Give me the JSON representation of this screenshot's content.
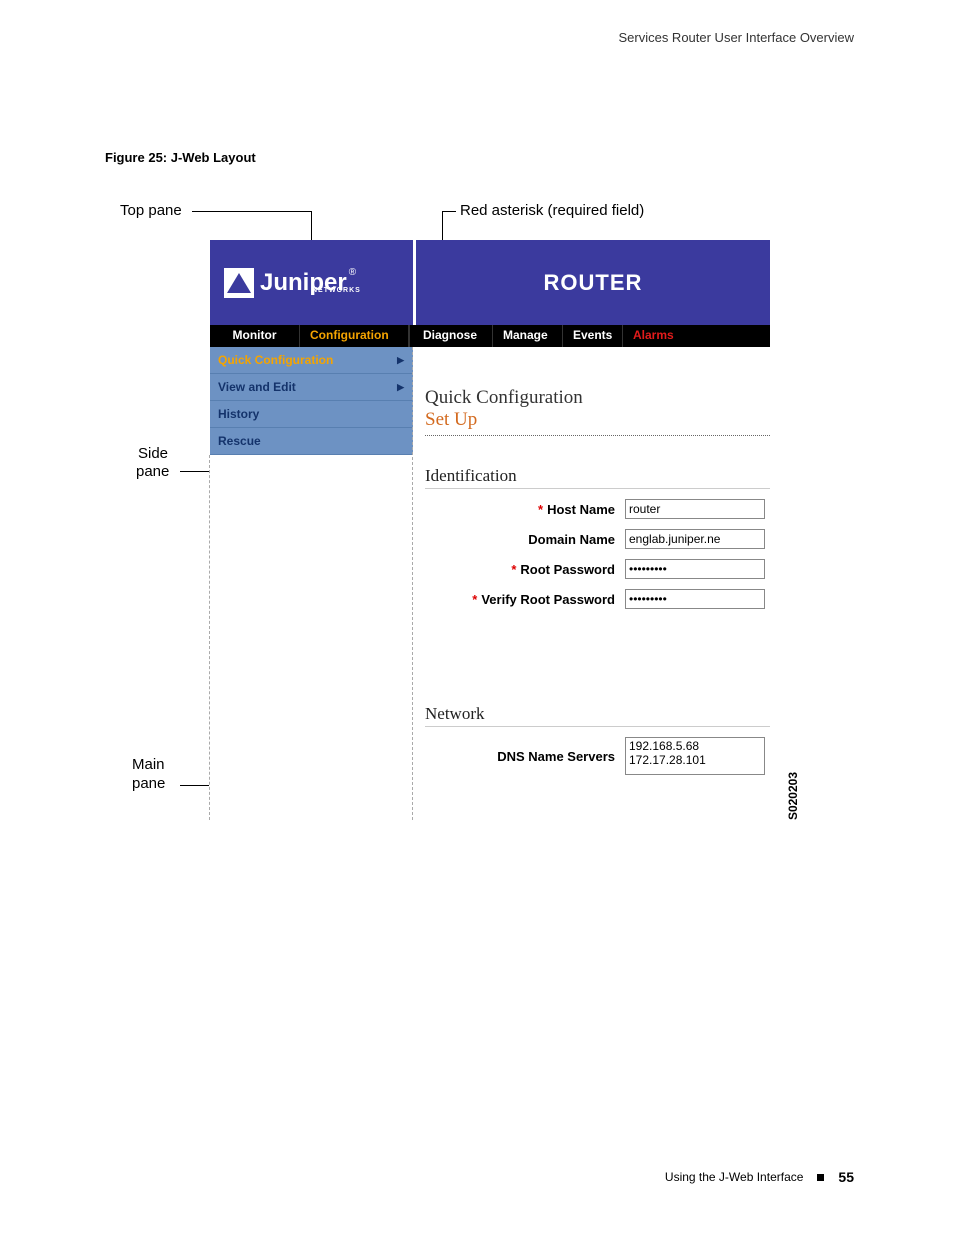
{
  "header_text": "Services Router User Interface Overview",
  "figure_caption": "Figure 25:  J-Web Layout",
  "annotations": {
    "top_pane": "Top pane",
    "red_asterisk": "Red asterisk (required field)",
    "side": "Side",
    "pane": "pane",
    "main": "Main",
    "pane2": "pane"
  },
  "logo": {
    "text": "Juniper",
    "sub": "NETWORKS",
    "reg": "®"
  },
  "router_title": "ROUTER",
  "tabs": {
    "monitor": "Monitor",
    "configuration": "Configuration",
    "diagnose": "Diagnose",
    "manage": "Manage",
    "events": "Events",
    "alarms": "Alarms"
  },
  "side_items": [
    {
      "label": "Quick Configuration",
      "active": true,
      "arrow": true
    },
    {
      "label": "View and Edit",
      "active": false,
      "arrow": true
    },
    {
      "label": "History",
      "active": false,
      "arrow": false
    },
    {
      "label": "Rescue",
      "active": false,
      "arrow": false
    }
  ],
  "main": {
    "title": "Quick Configuration",
    "sub": "Set Up",
    "section1": "Identification",
    "fields": {
      "host_name_label": "Host Name",
      "host_name_value": "router",
      "domain_name_label": "Domain Name",
      "domain_name_value": "englab.juniper.ne",
      "root_pw_label": "Root Password",
      "root_pw_value": "•••••••••",
      "verify_pw_label": "Verify Root Password",
      "verify_pw_value": "•••••••••"
    },
    "section2": "Network",
    "dns_label": "DNS Name Servers",
    "dns_values": "192.168.5.68\n172.17.28.101"
  },
  "refnum": "S020203",
  "footer": {
    "text": "Using the J-Web Interface",
    "page": "55"
  }
}
